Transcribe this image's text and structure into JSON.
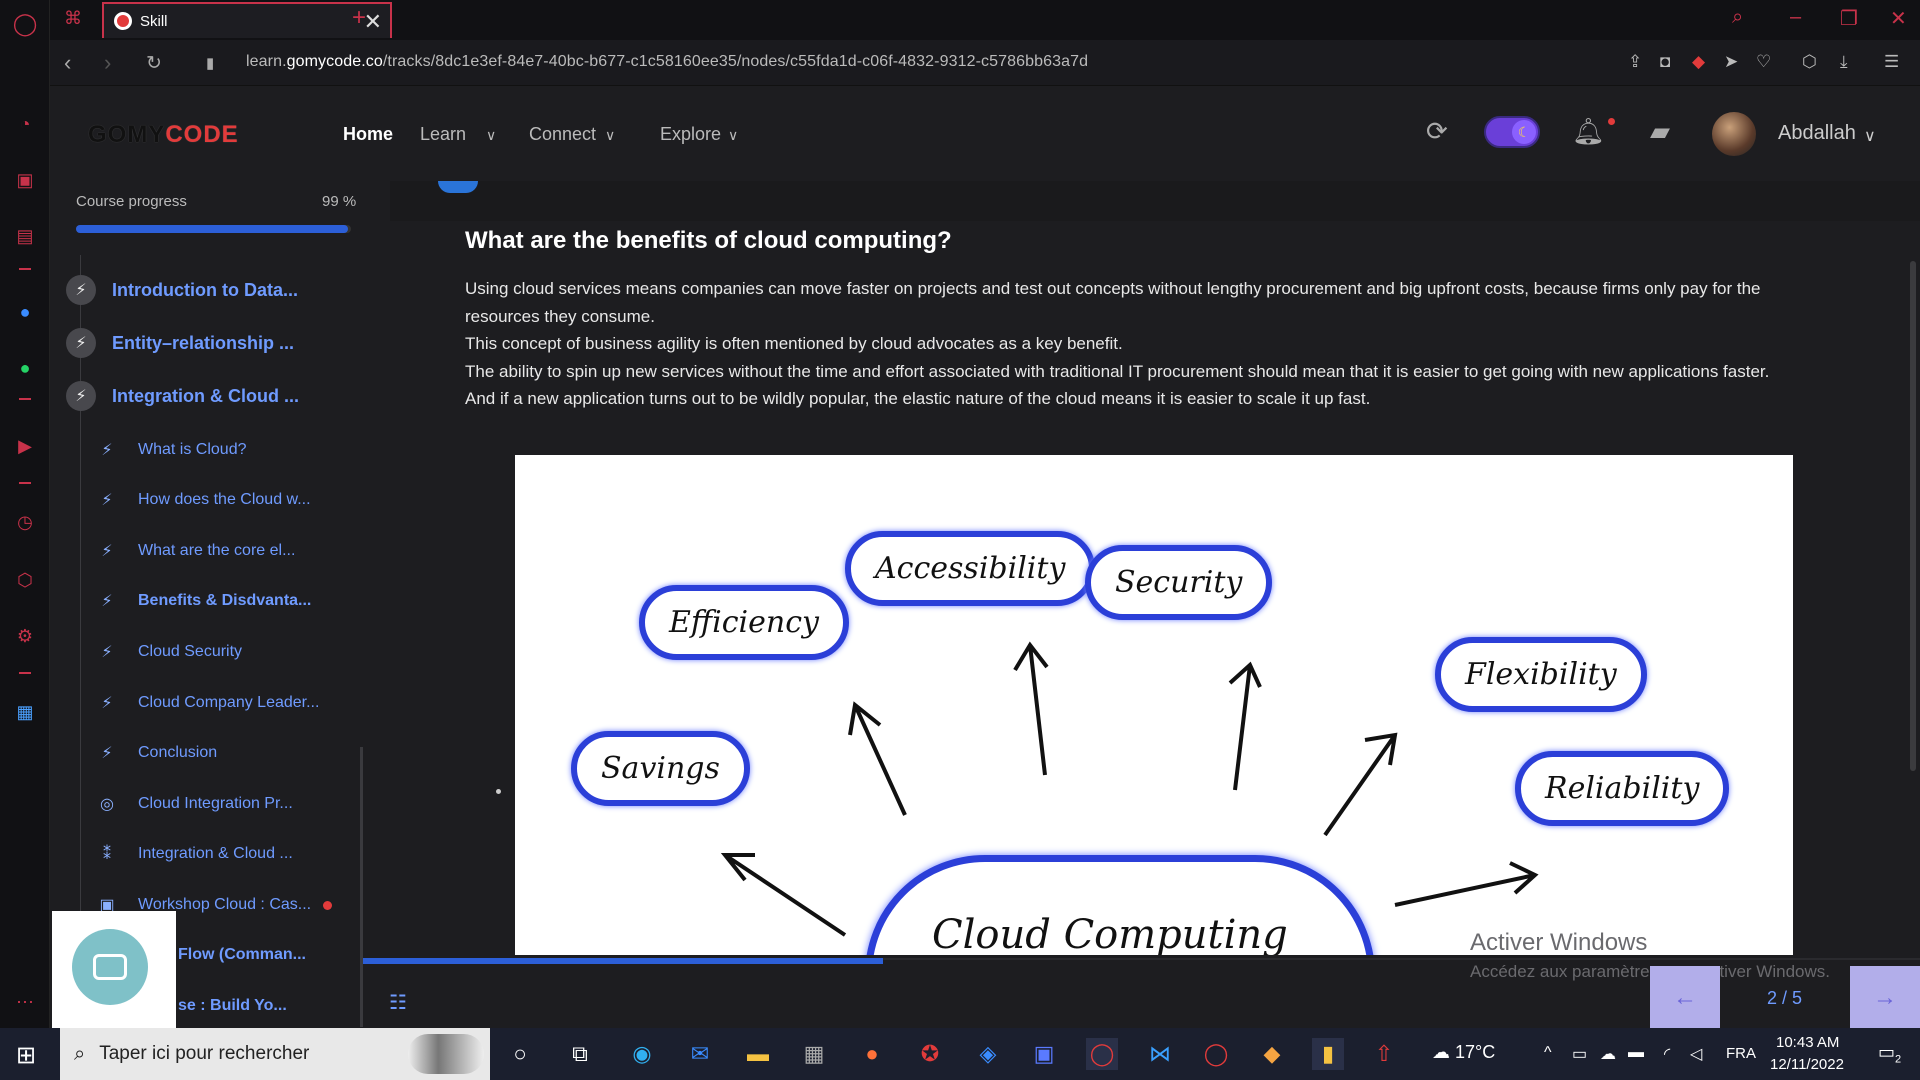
{
  "browser": {
    "tab_title": "Skill",
    "tab_close": "✕",
    "new_tab": "+",
    "url_prefix": "learn.",
    "url_domain": "gomycode.co",
    "url_path": "/tracks/8dc1e3ef-84e7-40bc-b677-c1c58160ee35/nodes/c55fda1d-c06f-4832-9312-c5786bb63a7d"
  },
  "site_header": {
    "logo_part1": "GOMY",
    "logo_part2": "CODE",
    "nav": [
      {
        "label": "Home"
      },
      {
        "label": "Learn"
      },
      {
        "label": "Connect"
      },
      {
        "label": "Explore"
      }
    ],
    "username": "Abdallah"
  },
  "course": {
    "progress_label": "Course progress",
    "progress_text": "99 %",
    "progress_value": 0.99,
    "modules": [
      {
        "label": "Introduction to Data..."
      },
      {
        "label": "Entity–relationship ..."
      },
      {
        "label": "Integration & Cloud ..."
      }
    ],
    "lessons": [
      {
        "label": "What is Cloud?"
      },
      {
        "label": "How does the Cloud w..."
      },
      {
        "label": "What are the core el..."
      },
      {
        "label": "Benefits & Disdvanta..."
      },
      {
        "label": "Cloud Security"
      },
      {
        "label": "Cloud Company Leader..."
      },
      {
        "label": "Conclusion"
      },
      {
        "label": "Cloud Integration Pr..."
      },
      {
        "label": "Integration & Cloud ..."
      },
      {
        "label": "Workshop Cloud : Cas..."
      },
      {
        "label": "Flow (Comman..."
      },
      {
        "label": "se : Build Yo..."
      }
    ]
  },
  "article": {
    "heading": "What are the benefits of cloud computing?",
    "paragraphs": [
      "Using cloud services means companies can move faster on projects and test out concepts without lengthy procurement and big upfront costs, because firms only pay for the resources they consume.",
      "This concept of business agility is often mentioned by cloud advocates as a key benefit.",
      "The ability to spin up new services without the time and effort associated with traditional IT procurement should mean that it is easier to get going with new applications faster.",
      "And if a new application turns out to be wildly popular, the elastic nature of the cloud means it is easier to scale it up fast."
    ],
    "figure_labels": {
      "accessibility": "Accessibility",
      "security": "Security",
      "efficiency": "Efficiency",
      "flexibility": "Flexibility",
      "savings": "Savings",
      "reliability": "Reliability",
      "center": "Cloud Computing"
    }
  },
  "footer": {
    "activate_title": "Activer Windows",
    "activate_sub": "Accédez aux paramètres pour activer Windows.",
    "page_count": "2 / 5",
    "prev": "←",
    "next": "→"
  },
  "taskbar": {
    "search_placeholder": "Taper ici pour rechercher",
    "weather": "17°C",
    "lang": "FRA",
    "time": "10:43 AM",
    "date": "12/11/2022",
    "notif_count": "2"
  }
}
